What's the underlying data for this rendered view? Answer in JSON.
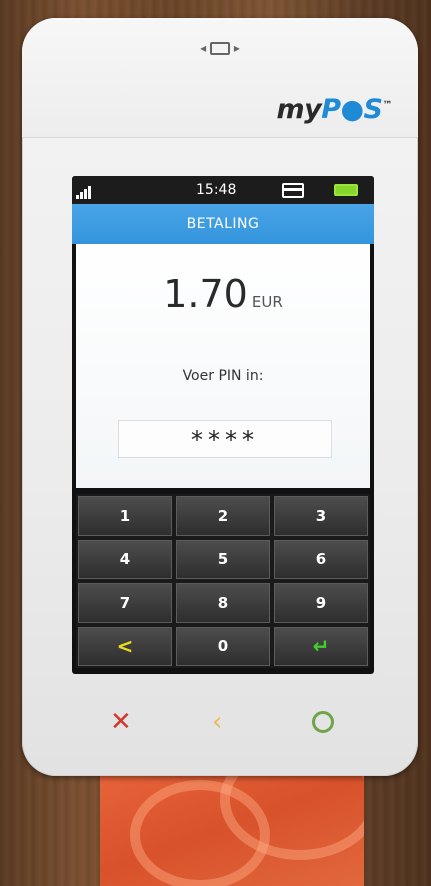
{
  "device": {
    "brand_prefix": "my",
    "brand_pos": "P●S",
    "brand_tm": "™",
    "slot_icon": "card-insert-icon"
  },
  "statusbar": {
    "time": "15:48",
    "signal_icon": "signal-bars-icon",
    "card_icon": "card-icon",
    "battery_icon": "battery-icon"
  },
  "screen": {
    "title": "BETALING",
    "amount": "1.70",
    "currency": "EUR",
    "prompt": "Voer PIN in:",
    "pin_mask": "****"
  },
  "keypad": {
    "keys": [
      "1",
      "2",
      "3",
      "4",
      "5",
      "6",
      "7",
      "8",
      "9",
      "<",
      "0",
      "↵"
    ]
  },
  "hardware_buttons": {
    "cancel": "✕",
    "clear": "‹",
    "ok": ""
  },
  "colors": {
    "title_bar": "#3394dc",
    "cancel": "#d23a2f",
    "clear": "#f0b95a",
    "ok": "#6fa54a",
    "back_key": "#ecdb1a",
    "enter_key": "#3fcf2c",
    "battery": "#86d62c"
  }
}
